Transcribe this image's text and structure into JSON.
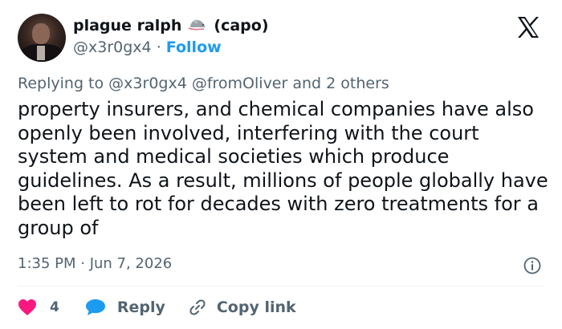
{
  "author": {
    "display_name": "plague ralph",
    "name_suffix": "(capo)",
    "name_icon": "rat-icon",
    "handle": "@x3r0gx4",
    "separator": "·",
    "follow_label": "Follow",
    "avatar": "profile-photo"
  },
  "platform_logo": "x-logo",
  "reply_context": {
    "prefix": "Replying to",
    "mentions": "@x3r0gx4 @fromOliver",
    "others": "and 2 others"
  },
  "tweet": {
    "text": "property insurers, and chemical companies have also openly been involved, interfering with the court system and medical societies which produce guidelines. As a result, millions of people globally have been left to rot for decades with zero treatments for a group of",
    "timestamp": "1:35 PM · Jun 7, 2026"
  },
  "actions": {
    "like_count": "4",
    "reply_label": "Reply",
    "copy_link_label": "Copy link"
  },
  "colors": {
    "accent": "#1d9bf0",
    "like": "#f91880",
    "text": "#0f1419",
    "secondary": "#536471"
  }
}
